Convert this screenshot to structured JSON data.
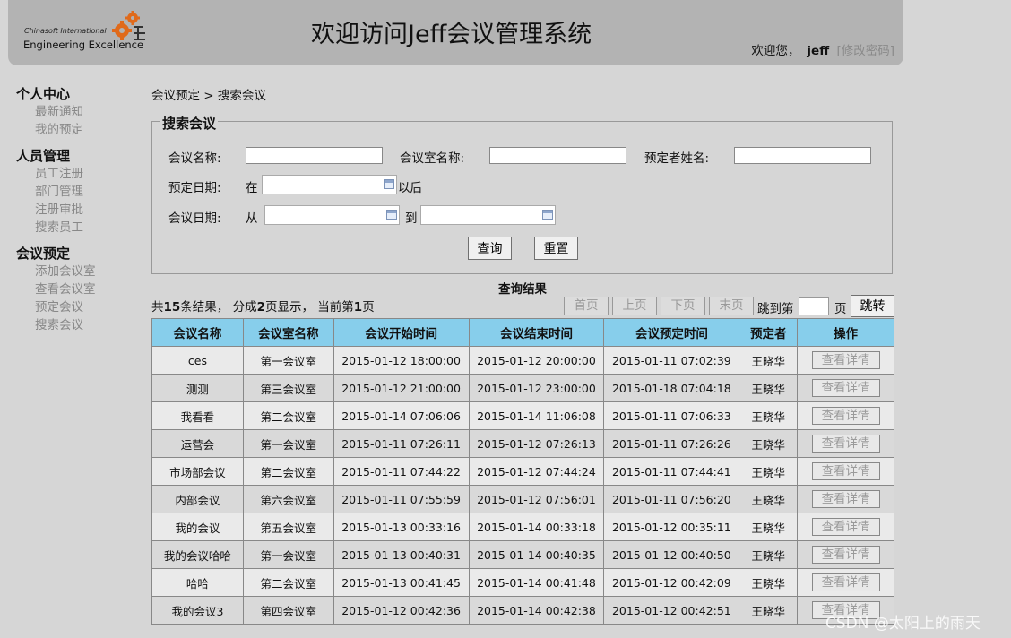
{
  "header": {
    "logo_line1": "Chinasoft International",
    "logo_line2": "Engineering Excellence",
    "title": "欢迎访问Jeff会议管理系统",
    "welcome_text": "欢迎您，",
    "username": "jeff",
    "change_password": "[修改密码]"
  },
  "sidebar": [
    {
      "title": "个人中心",
      "items": [
        "最新通知",
        "我的预定"
      ]
    },
    {
      "title": "人员管理",
      "items": [
        "员工注册",
        "部门管理",
        "注册审批",
        "搜索员工"
      ]
    },
    {
      "title": "会议预定",
      "items": [
        "添加会议室",
        "查看会议室",
        "预定会议",
        "搜索会议"
      ]
    }
  ],
  "breadcrumb": "会议预定 > 搜索会议",
  "search": {
    "legend": "搜索会议",
    "meeting_name_label": "会议名称:",
    "room_name_label": "会议室名称:",
    "booker_label": "预定者姓名:",
    "booking_date_label": "预定日期:",
    "booking_in": "在",
    "booking_after": "以后",
    "meeting_date_label": "会议日期:",
    "from": "从",
    "to": "到",
    "query_button": "查询",
    "reset_button": "重置"
  },
  "results": {
    "title": "查询结果",
    "summary_prefix": "共",
    "total": "15",
    "summary_mid1": "条结果，  分成",
    "pages": "2",
    "summary_mid2": "页显示，  当前第",
    "current": "1",
    "summary_suffix": "页",
    "first": "首页",
    "prev": "上页",
    "next": "下页",
    "last": "末页",
    "jump_to": "跳到第",
    "page_unit": "页",
    "jump_button": "跳转"
  },
  "table": {
    "headers": [
      "会议名称",
      "会议室名称",
      "会议开始时间",
      "会议结束时间",
      "会议预定时间",
      "预定者",
      "操作"
    ],
    "detail_label": "查看详情",
    "rows": [
      [
        "ces",
        "第一会议室",
        "2015-01-12 18:00:00",
        "2015-01-12 20:00:00",
        "2015-01-11 07:02:39",
        "王晓华"
      ],
      [
        "测测",
        "第三会议室",
        "2015-01-12 21:00:00",
        "2015-01-12 23:00:00",
        "2015-01-18 07:04:18",
        "王晓华"
      ],
      [
        "我看看",
        "第二会议室",
        "2015-01-14 07:06:06",
        "2015-01-14 11:06:08",
        "2015-01-11 07:06:33",
        "王晓华"
      ],
      [
        "运营会",
        "第一会议室",
        "2015-01-11 07:26:11",
        "2015-01-12 07:26:13",
        "2015-01-11 07:26:26",
        "王晓华"
      ],
      [
        "市场部会议",
        "第二会议室",
        "2015-01-11 07:44:22",
        "2015-01-12 07:44:24",
        "2015-01-11 07:44:41",
        "王晓华"
      ],
      [
        "内部会议",
        "第六会议室",
        "2015-01-11 07:55:59",
        "2015-01-12 07:56:01",
        "2015-01-11 07:56:20",
        "王晓华"
      ],
      [
        "我的会议",
        "第五会议室",
        "2015-01-13 00:33:16",
        "2015-01-14 00:33:18",
        "2015-01-12 00:35:11",
        "王晓华"
      ],
      [
        "我的会议哈哈",
        "第一会议室",
        "2015-01-13 00:40:31",
        "2015-01-14 00:40:35",
        "2015-01-12 00:40:50",
        "王晓华"
      ],
      [
        "哈哈",
        "第二会议室",
        "2015-01-13 00:41:45",
        "2015-01-14 00:41:48",
        "2015-01-12 00:42:09",
        "王晓华"
      ],
      [
        "我的会议3",
        "第四会议室",
        "2015-01-12 00:42:36",
        "2015-01-14 00:42:38",
        "2015-01-12 00:42:51",
        "王晓华"
      ]
    ]
  },
  "watermark": "CSDN @太阳上的雨天",
  "colors": {
    "header_bg": "#b3b3b3",
    "page_bg": "#d6d6d6",
    "table_header_bg": "#87ceeb",
    "logo_gear": "#e06a1b"
  }
}
